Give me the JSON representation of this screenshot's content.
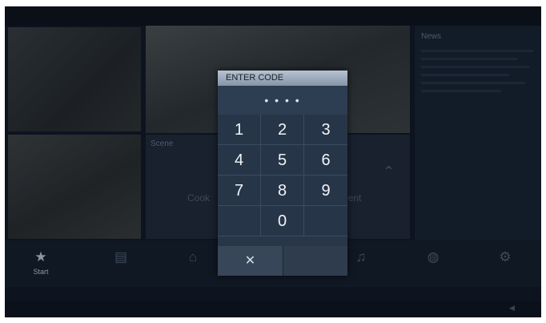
{
  "dialog": {
    "title": "ENTER CODE",
    "code_mask": "• • • •",
    "keys": [
      "1",
      "2",
      "3",
      "4",
      "5",
      "6",
      "7",
      "8",
      "9",
      "0"
    ],
    "clear_label": "✕",
    "confirm_label": ""
  },
  "background": {
    "scene_label": "Scene",
    "scene_item_left": "Cook",
    "scene_item_right": "ient",
    "news_label": "News",
    "nav": {
      "start_label": "Start"
    }
  },
  "icons": {
    "star": "star-icon",
    "clear": "close-icon"
  }
}
